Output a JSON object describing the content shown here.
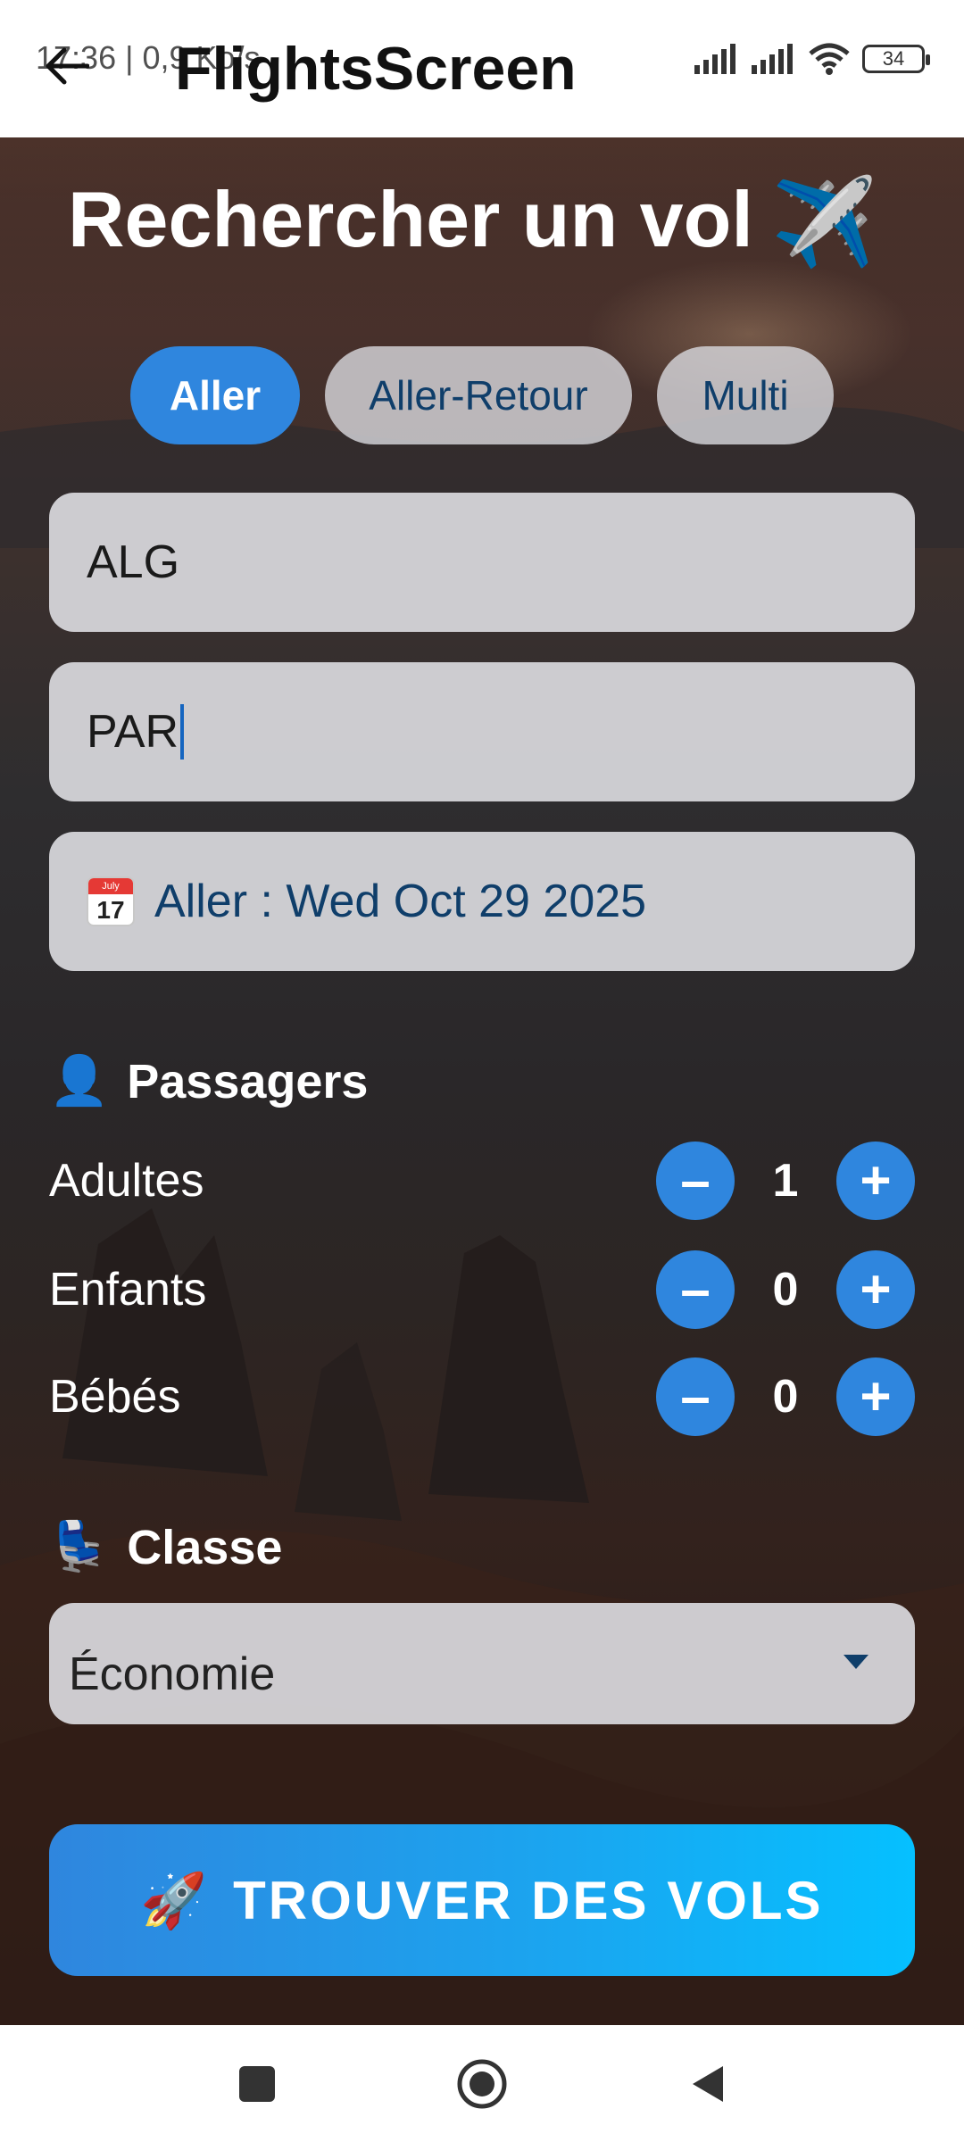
{
  "status_bar": {
    "time_and_speed": "17:36 | 0,9 Ko/s",
    "battery": "34"
  },
  "app_bar": {
    "title": "FlightsScreen",
    "back_icon": "arrow-left-icon"
  },
  "heading": {
    "text": "Rechercher un vol",
    "emoji": "✈️"
  },
  "trip_tabs": [
    {
      "label": "Aller",
      "active": true
    },
    {
      "label": "Aller-Retour",
      "active": false
    },
    {
      "label": "Multi",
      "active": false
    }
  ],
  "form": {
    "from_value": "ALG",
    "to_value": "PAR",
    "date_label": "Aller : Wed Oct 29 2025",
    "calendar_icon": {
      "month": "July",
      "day": "17"
    }
  },
  "passengers": {
    "title": "Passagers",
    "icon": "👤",
    "rows": [
      {
        "label": "Adultes",
        "value": "1"
      },
      {
        "label": "Enfants",
        "value": "0"
      },
      {
        "label": "Bébés",
        "value": "0"
      }
    ],
    "minus": "–",
    "plus": "+"
  },
  "cabin_class": {
    "title": "Classe",
    "icon": "💺",
    "selected": "Économie"
  },
  "cta": {
    "emoji": "🚀",
    "label": "TROUVER DES VOLS"
  },
  "colors": {
    "accent": "#2f86de",
    "cta_end": "#05c0ff",
    "field_bg": "#dadade",
    "text_dark_blue": "#0f3e6a"
  }
}
